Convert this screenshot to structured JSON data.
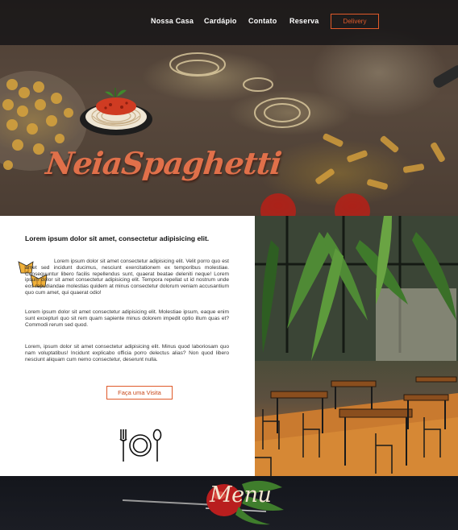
{
  "nav": {
    "items": [
      "Nossa Casa",
      "Cardápio",
      "Contato",
      "Reserva"
    ],
    "delivery_label": "Delivery"
  },
  "hero": {
    "brand": "NeiaSpaghetti"
  },
  "about": {
    "title": "Lorem ipsum dolor sit amet, consectetur adipisicing elit.",
    "paragraphs": [
      "Lorem ipsum dolor sit amet consectetur adipisicing elit. Velit porro quo est amet sed incidunt ducimus, nesciunt exercitationem ex temporibus molestiae. Consequuntur libero facilis repellendus sunt, quaerat beatae deleniti neque! Lorem ipsum dolor sit amet consectetur adipisicing elit. Tempora repellat ut id nostrum unde eos repudiandae molestias quidem at minus consectetur dolorum veniam accusantium quo cum amet, qui quaerat odio!",
      "Lorem ipsum dolor sit amet consectetur adipisicing elit. Molestiae ipsum, eaque enim sunt excepturi quo sit rem quam sapiente minus dolorem impedit optio illum quas et? Commodi rerum sed quod.",
      "Lorem, ipsum dolor sit amet consectetur adipisicing elit. Minus quod laboriosam quo nam voluptatibus! Incidunt explicabo officia porro delectus alias? Non quod libero nesciunt aliquam cum nemo consectetur, deserunt nulla."
    ],
    "visit_label": "Faça uma Visita"
  },
  "menu": {
    "title": "Menu"
  },
  "colors": {
    "accent": "#e05a2a",
    "topbar": "#121214",
    "menu_band": "#16181e"
  },
  "icons": [
    "pasta-dish-icon",
    "farfalle-icon",
    "plate-cutlery-icon",
    "fork-icon",
    "herb-icon"
  ]
}
